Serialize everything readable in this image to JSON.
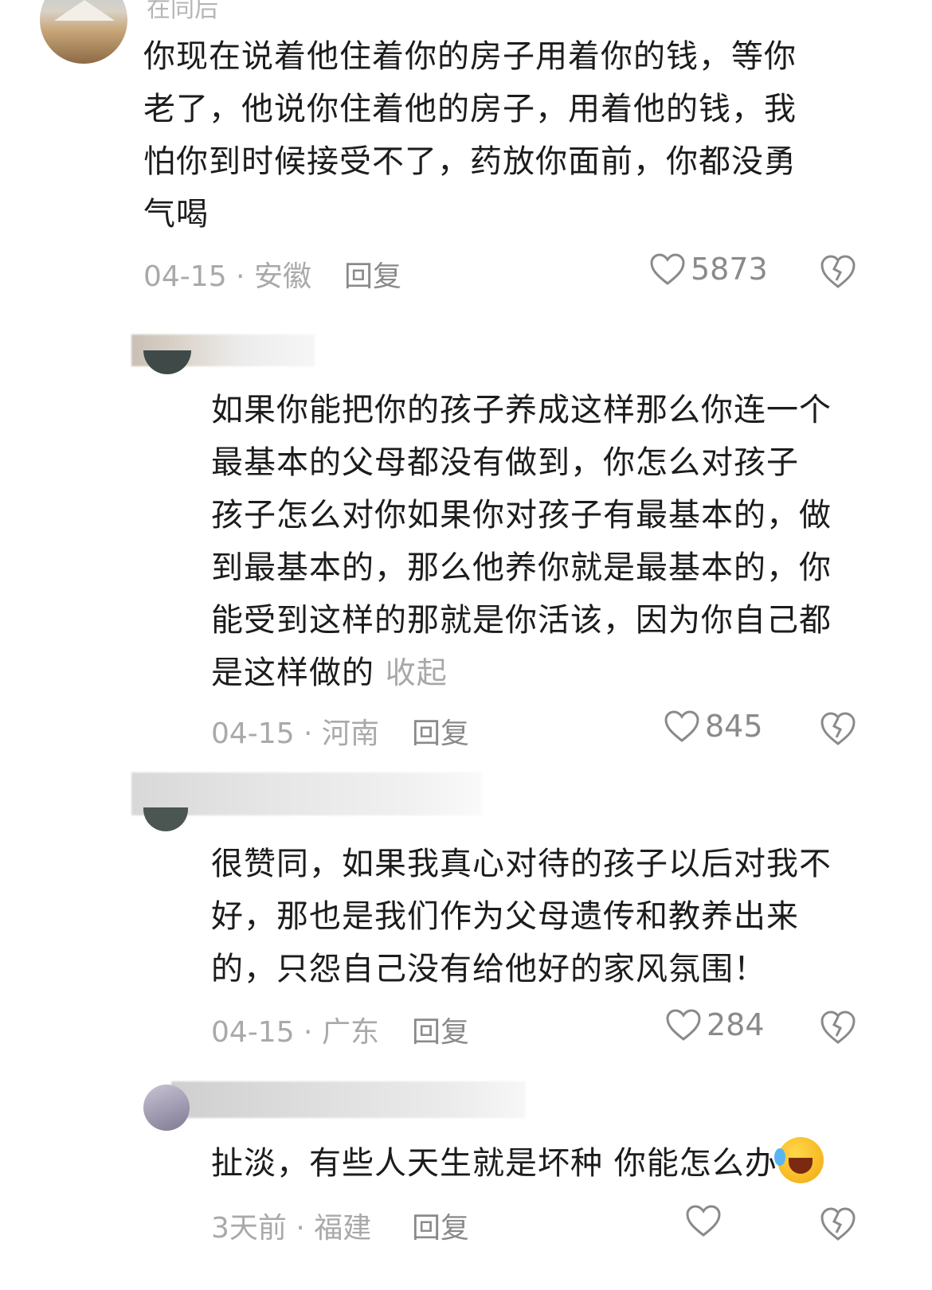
{
  "comments": [
    {
      "username": "在同后",
      "text": "你现在说着他住着你的房子用着你的钱，等你\n老了，他说你住着他的房子，用着他的钱，我\n怕你到时候接受不了，药放你面前，你都没勇\n气喝",
      "date_location": "04-15 · 安徽",
      "reply_label": "回复",
      "likes": "5873"
    },
    {
      "text": "如果你能把你的孩子养成这样那么你连一个\n最基本的父母都没有做到，你怎么对孩子\n孩子怎么对你如果你对孩子有最基本的，做\n到最基本的，那么他养你就是最基本的，你\n能受到这样的那就是你活该，因为你自己都\n是这样做的",
      "collapse_label": "收起",
      "date_location": "04-15 · 河南",
      "reply_label": "回复",
      "likes": "845"
    },
    {
      "text": "很赞同，如果我真心对待的孩子以后对我不\n好，那也是我们作为父母遗传和教养出来\n的，只怨自己没有给他好的家风氛围！",
      "date_location": "04-15 · 广东",
      "reply_label": "回复",
      "likes": "284"
    },
    {
      "text": "扯淡，有些人天生就是坏种 你能怎么办",
      "emoji": "crying-laughing-emoji",
      "date_location": "3天前 · 福建",
      "reply_label": "回复",
      "likes": ""
    }
  ],
  "icons": {
    "like": "heart-outline-icon",
    "dislike": "broken-heart-icon"
  },
  "colors": {
    "text": "#1c1c1c",
    "meta": "#a9a9a9",
    "icon": "#8a8a8a"
  }
}
